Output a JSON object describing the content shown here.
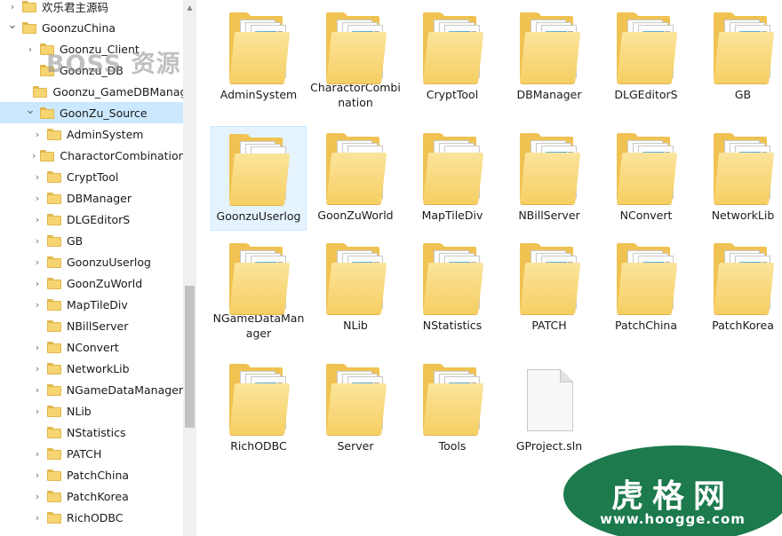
{
  "nav": {
    "items": [
      {
        "label": "欢乐君主源码",
        "expand": "collapsed",
        "level": 0
      },
      {
        "label": "GoonzuChina",
        "expand": "expanded",
        "level": 0
      },
      {
        "label": "Goonzu_Client",
        "expand": "collapsed",
        "level": 1
      },
      {
        "label": "Goonzu_DB",
        "expand": "none",
        "level": 1
      },
      {
        "label": "Goonzu_GameDBManager",
        "expand": "none",
        "level": 1
      },
      {
        "label": "GoonZu_Source",
        "expand": "expanded",
        "level": 1,
        "selected": true
      },
      {
        "label": "AdminSystem",
        "expand": "collapsed",
        "level": 2
      },
      {
        "label": "CharactorCombination",
        "expand": "collapsed",
        "level": 2
      },
      {
        "label": "CryptTool",
        "expand": "collapsed",
        "level": 2
      },
      {
        "label": "DBManager",
        "expand": "collapsed",
        "level": 2
      },
      {
        "label": "DLGEditorS",
        "expand": "collapsed",
        "level": 2
      },
      {
        "label": "GB",
        "expand": "collapsed",
        "level": 2
      },
      {
        "label": "GoonzuUserlog",
        "expand": "collapsed",
        "level": 2
      },
      {
        "label": "GoonZuWorld",
        "expand": "collapsed",
        "level": 2
      },
      {
        "label": "MapTileDiv",
        "expand": "collapsed",
        "level": 2
      },
      {
        "label": "NBillServer",
        "expand": "none",
        "level": 2
      },
      {
        "label": "NConvert",
        "expand": "collapsed",
        "level": 2
      },
      {
        "label": "NetworkLib",
        "expand": "collapsed",
        "level": 2
      },
      {
        "label": "NGameDataManager",
        "expand": "collapsed",
        "level": 2
      },
      {
        "label": "NLib",
        "expand": "collapsed",
        "level": 2
      },
      {
        "label": "NStatistics",
        "expand": "none",
        "level": 2
      },
      {
        "label": "PATCH",
        "expand": "collapsed",
        "level": 2
      },
      {
        "label": "PatchChina",
        "expand": "collapsed",
        "level": 2
      },
      {
        "label": "PatchKorea",
        "expand": "collapsed",
        "level": 2
      },
      {
        "label": "RichODBC",
        "expand": "collapsed",
        "level": 2
      }
    ]
  },
  "content": {
    "items": [
      {
        "label": "AdminSystem",
        "icon": "folder-docs-icon"
      },
      {
        "label": "CharactorCombination",
        "icon": "folder-docs-icon"
      },
      {
        "label": "CryptTool",
        "icon": "folder-docs-icon"
      },
      {
        "label": "DBManager",
        "icon": "folder-docs-icon"
      },
      {
        "label": "DLGEditorS",
        "icon": "folder-docs-icon"
      },
      {
        "label": "GB",
        "icon": "folder-docs-icon"
      },
      {
        "label": "GoonzuUserlog",
        "icon": "folder-empty-icon",
        "selected": true
      },
      {
        "label": "GoonZuWorld",
        "icon": "folder-settings-icon"
      },
      {
        "label": "MapTileDiv",
        "icon": "folder-empty-icon"
      },
      {
        "label": "NBillServer",
        "icon": "folder-docs-icon"
      },
      {
        "label": "NConvert",
        "icon": "folder-docs-icon"
      },
      {
        "label": "NetworkLib",
        "icon": "folder-docs-icon"
      },
      {
        "label": "NGameDataManager",
        "icon": "folder-docs-icon"
      },
      {
        "label": "NLib",
        "icon": "folder-docs-icon"
      },
      {
        "label": "NStatistics",
        "icon": "folder-docs-icon"
      },
      {
        "label": "PATCH",
        "icon": "folder-docs-icon"
      },
      {
        "label": "PatchChina",
        "icon": "folder-docs-icon"
      },
      {
        "label": "PatchKorea",
        "icon": "folder-docs-icon"
      },
      {
        "label": "RichODBC",
        "icon": "folder-docs-icon"
      },
      {
        "label": "Server",
        "icon": "folder-docs-icon"
      },
      {
        "label": "Tools",
        "icon": "folder-docs-icon"
      },
      {
        "label": "GProject.sln",
        "icon": "file-icon"
      }
    ]
  },
  "watermarks": {
    "boss": "BOSS 资源",
    "badge_title": "虎格网",
    "badge_url": "www.hoogge.com"
  },
  "colors": {
    "folder": "#f6d472",
    "selection": "#cce8ff",
    "badge": "#1c7a4d"
  }
}
